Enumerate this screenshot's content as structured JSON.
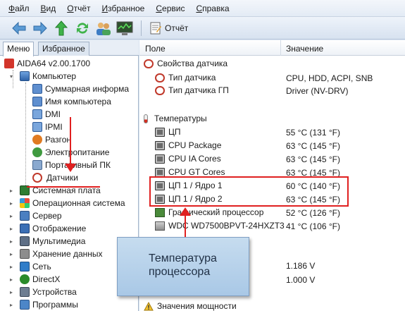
{
  "menu": [
    "Файл",
    "Вид",
    "Отчёт",
    "Избранное",
    "Сервис",
    "Справка"
  ],
  "toolbar": {
    "buttons": [
      "back-arrow-icon",
      "forward-arrow-icon",
      "up-arrow-icon",
      "refresh-icon",
      "users-icon",
      "monitor-icon"
    ],
    "report_label": "Отчёт"
  },
  "left_panel": {
    "tabs": [
      "Меню",
      "Избранное"
    ],
    "tree": {
      "root": "AIDA64 v2.00.1700",
      "computer": "Компьютер",
      "computer_children": [
        "Суммарная информа",
        "Имя компьютера",
        "DMI",
        "IPMI",
        "Разгон",
        "Электропитание",
        "Портативный ПК",
        "Датчики"
      ],
      "top_level": [
        "Системная плата",
        "Операционная система",
        "Сервер",
        "Отображение",
        "Мультимедиа",
        "Хранение данных",
        "Сеть",
        "DirectX",
        "Устройства",
        "Программы"
      ]
    }
  },
  "right_panel": {
    "columns": {
      "field": "Поле",
      "value": "Значение"
    },
    "sections": {
      "sensor_props": "Свойства датчика",
      "temperatures": "Температуры",
      "power": "Значения мощности"
    },
    "sensor_rows": [
      {
        "field": "Тип датчика",
        "value": "CPU, HDD, ACPI, SNB"
      },
      {
        "field": "Тип датчика ГП",
        "value": "Driver  (NV-DRV)"
      }
    ],
    "temp_rows": [
      {
        "field": "ЦП",
        "value": "55 °C  (131 °F)"
      },
      {
        "field": "CPU Package",
        "value": "63 °C  (145 °F)"
      },
      {
        "field": "CPU IA Cores",
        "value": "63 °C  (145 °F)"
      },
      {
        "field": "CPU GT Cores",
        "value": "63 °C  (145 °F)"
      },
      {
        "field": "ЦП 1 / Ядро 1",
        "value": "60 °C  (140 °F)"
      },
      {
        "field": "ЦП 1 / Ядро 2",
        "value": "63 °C  (145 °F)"
      },
      {
        "field": "Графический процессор",
        "value": "52 °C  (126 °F)"
      },
      {
        "field": "WDC WD7500BPVT-24HXZT3",
        "value": "41 °C  (106 °F)"
      }
    ],
    "voltage_values": [
      "1.186 V",
      "1.000 V"
    ]
  },
  "annotation": {
    "callout_line1": "Температура",
    "callout_line2": "процессора"
  },
  "colors": {
    "highlight": "#e02020",
    "callout_bg": "#b8d2ea",
    "chrome": "#d9e4f1"
  }
}
